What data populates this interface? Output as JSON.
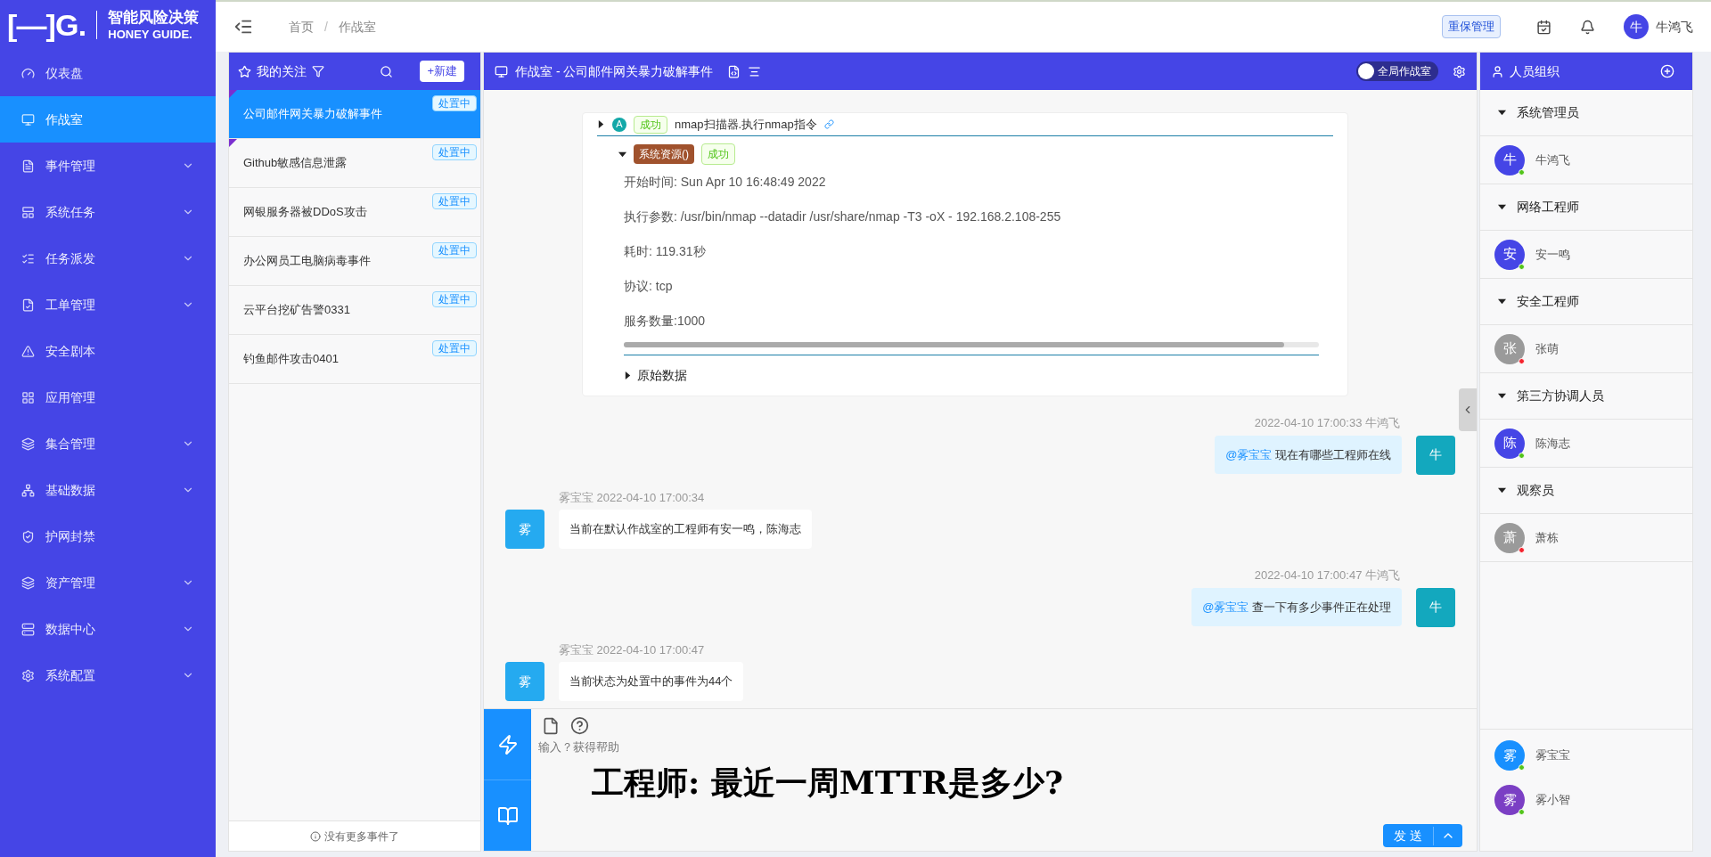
{
  "logo": {
    "mark": "[—]G.",
    "title": "智能风险决策",
    "subtitle": "HONEY GUIDE."
  },
  "sidebar": {
    "items": [
      {
        "label": "仪表盘",
        "selected": false,
        "expandable": false
      },
      {
        "label": "作战室",
        "selected": true,
        "expandable": false
      },
      {
        "label": "事件管理",
        "selected": false,
        "expandable": true
      },
      {
        "label": "系统任务",
        "selected": false,
        "expandable": true
      },
      {
        "label": "任务派发",
        "selected": false,
        "expandable": true
      },
      {
        "label": "工单管理",
        "selected": false,
        "expandable": true
      },
      {
        "label": "安全剧本",
        "selected": false,
        "expandable": false
      },
      {
        "label": "应用管理",
        "selected": false,
        "expandable": false
      },
      {
        "label": "集合管理",
        "selected": false,
        "expandable": true
      },
      {
        "label": "基础数据",
        "selected": false,
        "expandable": true
      },
      {
        "label": "护网封禁",
        "selected": false,
        "expandable": false
      },
      {
        "label": "资产管理",
        "selected": false,
        "expandable": true
      },
      {
        "label": "数据中心",
        "selected": false,
        "expandable": true
      },
      {
        "label": "系统配置",
        "selected": false,
        "expandable": true
      }
    ]
  },
  "header": {
    "breadcrumb": [
      "首页",
      "作战室"
    ],
    "breadcrumb_separator": "/",
    "tag": "重保管理",
    "user": {
      "avatar": "牛",
      "name": "牛鸿飞"
    }
  },
  "events_panel": {
    "title": "我的关注",
    "new_button": "+新建",
    "items": [
      {
        "title": "公司邮件网关暴力破解事件",
        "status": "处置中",
        "selected": true,
        "flagged": true
      },
      {
        "title": "Github敏感信息泄露",
        "status": "处置中",
        "selected": false,
        "flagged": true
      },
      {
        "title": "网银服务器被DDoS攻击",
        "status": "处置中",
        "selected": false,
        "flagged": false
      },
      {
        "title": "办公网员工电脑病毒事件",
        "status": "处置中",
        "selected": false,
        "flagged": false
      },
      {
        "title": "云平台挖矿告警0331",
        "status": "处置中",
        "selected": false,
        "flagged": false
      },
      {
        "title": "钓鱼邮件攻击0401",
        "status": "处置中",
        "selected": false,
        "flagged": false
      }
    ],
    "footer": "没有更多事件了"
  },
  "chat_panel": {
    "title": "作战室 - 公司邮件网关暴力破解事件",
    "global_toggle": {
      "label": "全局作战室",
      "on": false
    },
    "result_card": {
      "step": {
        "avatar": "A",
        "status": "成功",
        "text": "nmap扫描器.执行nmap指令"
      },
      "resource": {
        "tag": "系统资源()",
        "status": "成功",
        "expanded": true,
        "fields": [
          "开始时间: Sun Apr 10 16:48:49 2022",
          "执行参数: /usr/bin/nmap --datadir /usr/share/nmap -T3 -oX - 192.168.2.108-255",
          "耗时: 119.31秒",
          "协议: tcp",
          "服务数量:1000"
        ]
      },
      "raw": {
        "label": "原始数据",
        "expanded": false
      }
    },
    "messages": [
      {
        "kind": "outgoing",
        "meta": "2022-04-10 17:00:33 牛鸿飞",
        "avatar": "牛",
        "mention": "@雾宝宝",
        "text": "现在有哪些工程师在线"
      },
      {
        "kind": "incoming",
        "meta": "雾宝宝 2022-04-10 17:00:34",
        "avatar": "雾",
        "text": "当前在默认作战室的工程师有安一鸣，陈海志"
      },
      {
        "kind": "outgoing",
        "meta": "2022-04-10 17:00:47 牛鸿飞",
        "avatar": "牛",
        "mention": "@雾宝宝",
        "text": "查一下有多少事件正在处理"
      },
      {
        "kind": "incoming",
        "meta": "雾宝宝 2022-04-10 17:00:47",
        "avatar": "雾",
        "text": "当前状态为处置中的事件为44个"
      }
    ],
    "input": {
      "placeholder": "输入？获得帮助",
      "send": "发 送"
    },
    "subtitle": "工程师: 最近一周MTTR是多少?"
  },
  "people_panel": {
    "title": "人员组织",
    "groups": [
      {
        "name": "系统管理员",
        "expanded": true,
        "members": [
          {
            "avatar": "牛",
            "name": "牛鸿飞",
            "online": true
          }
        ]
      },
      {
        "name": "网络工程师",
        "expanded": true,
        "members": [
          {
            "avatar": "安",
            "name": "安一鸣",
            "online": true
          }
        ]
      },
      {
        "name": "安全工程师",
        "expanded": true,
        "members": [
          {
            "avatar": "张",
            "name": "张萌",
            "online": false
          }
        ]
      },
      {
        "name": "第三方协调人员",
        "expanded": true,
        "members": [
          {
            "avatar": "陈",
            "name": "陈海志",
            "online": true
          }
        ]
      },
      {
        "name": "观察员",
        "expanded": true,
        "members": [
          {
            "avatar": "萧",
            "name": "萧栋",
            "online": false
          }
        ]
      }
    ],
    "bots": [
      {
        "avatar": "雾",
        "name": "雾宝宝",
        "color": "#1890ff"
      },
      {
        "avatar": "雾",
        "name": "雾小智",
        "color": "#7b3fc4"
      }
    ]
  }
}
